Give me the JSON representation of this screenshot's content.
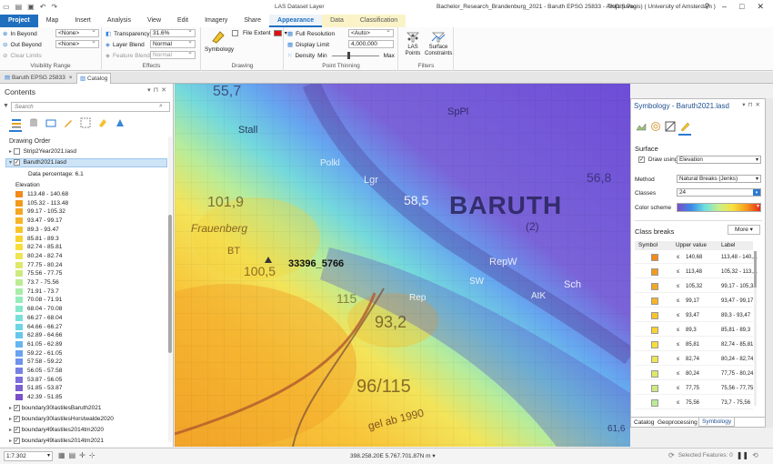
{
  "window": {
    "title": "Bachelor_Research_Brandenburg_2021 - Baruth EPSG 25833 - ArcGIS Pro",
    "context_label": "LAS Dataset Layer",
    "user": "Thijs (uvagis) ( University of Amsterdam )",
    "controls": [
      "?",
      "–",
      "□",
      "✕"
    ]
  },
  "ribbon_tabs": [
    {
      "label": "Project"
    },
    {
      "label": "Map"
    },
    {
      "label": "Insert"
    },
    {
      "label": "Analysis"
    },
    {
      "label": "View"
    },
    {
      "label": "Edit"
    },
    {
      "label": "Imagery"
    },
    {
      "label": "Share"
    },
    {
      "label": "Appearance"
    },
    {
      "label": "Data"
    },
    {
      "label": "Classification"
    }
  ],
  "ribbon": {
    "visibility_range": {
      "label": "Visibility Range",
      "in_beyond": "In Beyond",
      "out_beyond": "Out Beyond",
      "clear_limits": "Clear Limits",
      "in_value": "<None>",
      "out_value": "<None>"
    },
    "effects": {
      "label": "Effects",
      "transparency": "Transparency",
      "transparency_value": "31.6%",
      "layer_blend": "Layer Blend",
      "layer_blend_value": "Normal",
      "feature_blend": "Feature Blend",
      "feature_blend_value": "Normal"
    },
    "drawing": {
      "label": "Drawing",
      "symbology": "Symbology",
      "file_extent": "File Extent"
    },
    "point_thinning": {
      "label": "Point Thinning",
      "full_resolution": "Full Resolution",
      "full_resolution_value": "<Auto>",
      "display_limit": "Display Limit",
      "display_limit_value": "4,000,000",
      "density": "Density",
      "min": "Min",
      "max": "Max"
    },
    "filters": {
      "label": "Filters",
      "las_points": "LAS\nPoints",
      "surface_constraints": "Surface\nConstraints"
    }
  },
  "doc_tabs": [
    {
      "label": "Baruth EPSG 25833"
    },
    {
      "label": "Catalog"
    }
  ],
  "contents": {
    "title": "Contents",
    "search_placeholder": "Search",
    "drawing_order": "Drawing Order",
    "layers": [
      {
        "name": "Strip2Year2021.lasd",
        "checked": false
      },
      {
        "name": "Baruth2021.lasd",
        "checked": true
      }
    ],
    "data_percentage": "Data percentage: 6.1",
    "elevation": "Elevation",
    "legend": [
      {
        "range": "113.48 - 140.68",
        "color": "#f28b18"
      },
      {
        "range": "105.32 - 113.48",
        "color": "#f39a1c"
      },
      {
        "range": "99.17 - 105.32",
        "color": "#f5a623"
      },
      {
        "range": "93.47 - 99.17",
        "color": "#f7b427"
      },
      {
        "range": "89.3 - 93.47",
        "color": "#f9c42b"
      },
      {
        "range": "85.81 - 89.3",
        "color": "#fbd22e"
      },
      {
        "range": "82.74 - 85.81",
        "color": "#f9de3a"
      },
      {
        "range": "80.24 - 82.74",
        "color": "#eee553"
      },
      {
        "range": "77.75 - 80.24",
        "color": "#dfe86a"
      },
      {
        "range": "75.56 - 77.75",
        "color": "#cdea7f"
      },
      {
        "range": "73.7 - 75.56",
        "color": "#bbec93"
      },
      {
        "range": "71.91 - 73.7",
        "color": "#a7eda8"
      },
      {
        "range": "70.08 - 71.91",
        "color": "#96ecbb"
      },
      {
        "range": "68.04 - 70.08",
        "color": "#87e7cb"
      },
      {
        "range": "66.27 - 68.04",
        "color": "#7adfd9"
      },
      {
        "range": "64.66 - 66.27",
        "color": "#6fd4e5"
      },
      {
        "range": "62.89 - 64.66",
        "color": "#68c6ee"
      },
      {
        "range": "61.05 - 62.89",
        "color": "#66b6f1"
      },
      {
        "range": "59.22 - 61.05",
        "color": "#6aa4ef"
      },
      {
        "range": "57.58 - 59.22",
        "color": "#7092ea"
      },
      {
        "range": "56.05 - 57.58",
        "color": "#7680e4"
      },
      {
        "range": "53.87 - 56.05",
        "color": "#7b6fdc"
      },
      {
        "range": "51.85 - 53.87",
        "color": "#7b5fd3"
      },
      {
        "range": "42.39 - 51.85",
        "color": "#7a4fc9"
      }
    ],
    "bottom_layers": [
      {
        "name": "boundary30lastilesBaruth2021",
        "checked": true
      },
      {
        "name": "boundary30lastilesHorstwalde2020",
        "checked": true
      },
      {
        "name": "boundary49lastiles2014tm2020",
        "checked": true
      },
      {
        "name": "boundary49lastiles2014tm2021",
        "checked": true
      }
    ]
  },
  "map": {
    "town": "BARUTH",
    "numbers": [
      "55,7",
      "101,9",
      "58,5",
      "56,8",
      "100,5",
      "93,2",
      "96/115",
      "115",
      "61,6"
    ],
    "words": [
      "Stall",
      "Polkl",
      "Lgr",
      "SpPl",
      "Frauenberg",
      "BT",
      "RepW",
      "Sch",
      "gel ab 1990",
      "(2)",
      "SW",
      "AtK",
      "Rep"
    ],
    "annotation": "33396_5766"
  },
  "symbology": {
    "title": "Symbology - Baruth2021.lasd",
    "surface": "Surface",
    "draw_using_label": "Draw using",
    "draw_using_value": "Elevation",
    "method_label": "Method",
    "method_value": "Natural Breaks (Jenks)",
    "classes_label": "Classes",
    "classes_value": "24",
    "color_scheme_label": "Color scheme",
    "class_breaks": "Class breaks",
    "more": "More",
    "headers": {
      "symbol": "Symbol",
      "upper": "Upper value",
      "label": "Label"
    },
    "rows": [
      {
        "le": "≤",
        "upper": "140,68",
        "label": "113,48 - 140,...",
        "color": "#f28b18"
      },
      {
        "le": "≤",
        "upper": "113,48",
        "label": "105,32 - 113,...",
        "color": "#f39a1c"
      },
      {
        "le": "≤",
        "upper": "105,32",
        "label": "99,17 - 105,32",
        "color": "#f5a623"
      },
      {
        "le": "≤",
        "upper": "99,17",
        "label": "93,47 - 99,17",
        "color": "#f7b427"
      },
      {
        "le": "≤",
        "upper": "93,47",
        "label": "89,3 - 93,47",
        "color": "#f9c42b"
      },
      {
        "le": "≤",
        "upper": "89,3",
        "label": "85,81 - 89,3",
        "color": "#fbd22e"
      },
      {
        "le": "≤",
        "upper": "85,81",
        "label": "82,74 - 85,81",
        "color": "#f9de3a"
      },
      {
        "le": "≤",
        "upper": "82,74",
        "label": "80,24 - 82,74",
        "color": "#eee553"
      },
      {
        "le": "≤",
        "upper": "80,24",
        "label": "77,75 - 80,24",
        "color": "#dfe86a"
      },
      {
        "le": "≤",
        "upper": "77,75",
        "label": "75,56 - 77,75",
        "color": "#cdea7f"
      },
      {
        "le": "≤",
        "upper": "75,56",
        "label": "73,7 - 75,56",
        "color": "#bbec93"
      }
    ],
    "bottom_tabs": [
      "Catalog",
      "Geoprocessing",
      "Symbology"
    ]
  },
  "status": {
    "scale": "1:7.302",
    "coordinates": "398.258.20E 5.767.701.87N m",
    "selected_features": "Selected Features: 0"
  }
}
